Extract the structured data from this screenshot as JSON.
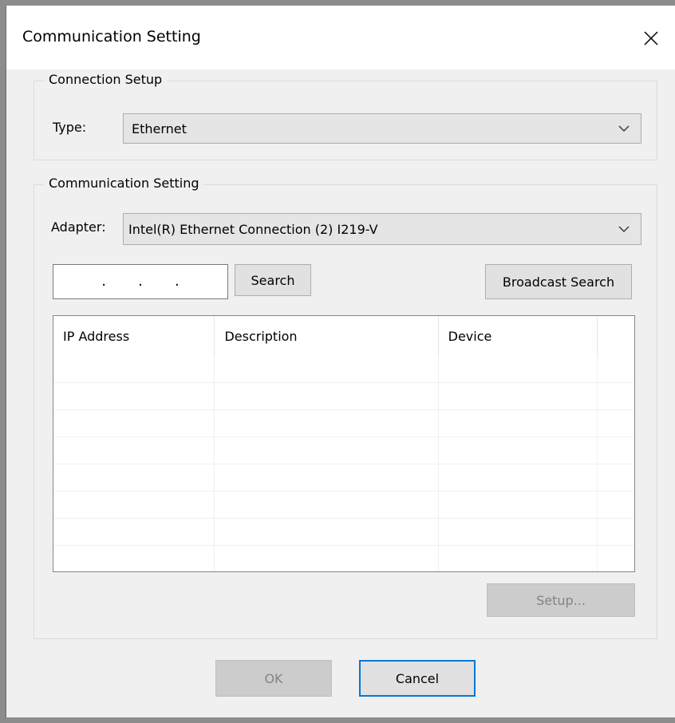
{
  "window": {
    "title": "Communication Setting",
    "close_symbol": "✕"
  },
  "connection_setup": {
    "group_label": "Connection Setup",
    "type_label": "Type:",
    "type_value": "Ethernet"
  },
  "communication_setting": {
    "group_label": "Communication Setting",
    "adapter_label": "Adapter:",
    "adapter_value": "Intel(R) Ethernet Connection (2) I219-V",
    "ip_dots": [
      ".",
      ".",
      "."
    ],
    "search_label": "Search",
    "broadcast_label": "Broadcast Search",
    "table": {
      "columns": [
        "IP Address",
        "Description",
        "Device",
        ""
      ],
      "rows": [
        [
          "",
          "",
          "",
          ""
        ],
        [
          "",
          "",
          "",
          ""
        ],
        [
          "",
          "",
          "",
          ""
        ],
        [
          "",
          "",
          "",
          ""
        ],
        [
          "",
          "",
          "",
          ""
        ],
        [
          "",
          "",
          "",
          ""
        ],
        [
          "",
          "",
          "",
          ""
        ],
        [
          "",
          "",
          "",
          ""
        ]
      ]
    },
    "setup_label": "Setup..."
  },
  "footer": {
    "ok_label": "OK",
    "cancel_label": "Cancel"
  },
  "colors": {
    "accent": "#0078d7",
    "disabled_text": "#838383"
  },
  "icons": {
    "close": "close-icon",
    "dropdown": "chevron-down-icon"
  }
}
